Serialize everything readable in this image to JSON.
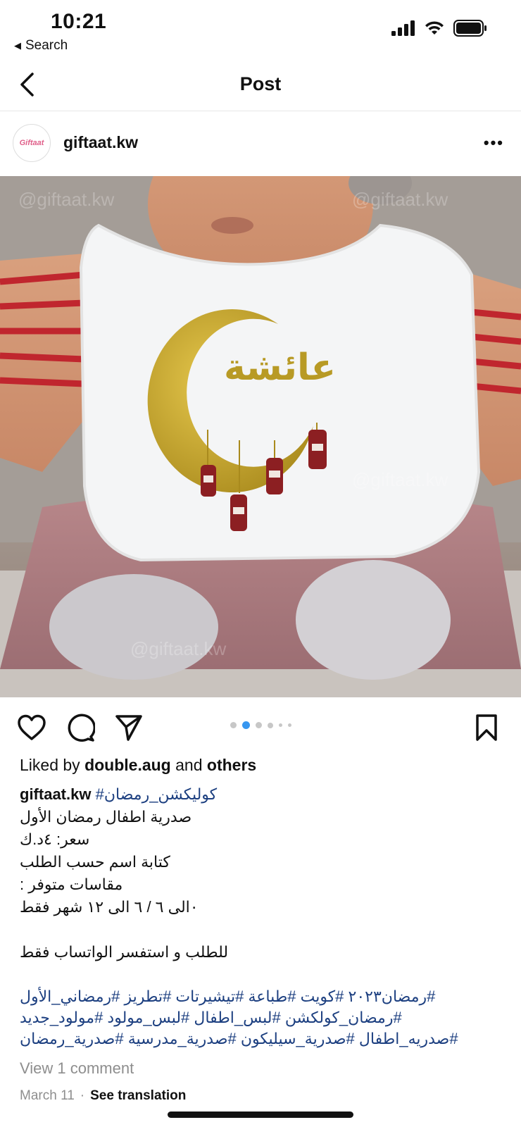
{
  "status_bar": {
    "time": "10:21",
    "back_label": "Search",
    "icons": [
      "cellular-signal-icon",
      "wifi-icon",
      "battery-icon"
    ]
  },
  "nav": {
    "title": "Post"
  },
  "post": {
    "username": "giftaat.kw",
    "avatar_text": "Giftaat",
    "image_watermark": "@giftaat.kw",
    "bib_name": "عائشة",
    "carousel": {
      "count": 6,
      "active_index": 1
    }
  },
  "caption": {
    "liked_prefix": "Liked by",
    "liked_user": "double.aug",
    "liked_and": "and",
    "liked_others": "others",
    "username": "giftaat.kw",
    "first_tag": "#كوليكشن_رمضان",
    "lines": [
      "صدرية اطفال  رمضان الأول",
      "سعر: ٤د.ك",
      "كتابة اسم حسب الطلب",
      "مقاسات متوفر :",
      "٠الى ٦ /  ٦ الى ١٢ شهر فقط",
      "",
      "للطلب و استفسر الواتساب فقط",
      ""
    ],
    "hashtag_lines": [
      "#رمضان٢٠٢٣ #كويت #طباعة #تيشيرتات #تطريز #رمضاني_الأول",
      "#رمضان_كولكشن #لبس_اطفال #لبس_مولود #مولود_جديد",
      "#صدريه_اطفال #صدرية_سيليكون #صدرية_مدرسية #صدرية_رمضان"
    ]
  },
  "comments": {
    "view_label": "View 1 comment"
  },
  "meta": {
    "date": "March 11",
    "separator": "·",
    "translate_label": "See translation"
  },
  "colors": {
    "hashtag": "#1c3f80",
    "dot_active": "#3797f0",
    "dot_inactive": "#c7c7c7",
    "muted_text": "#8e8e8e"
  }
}
